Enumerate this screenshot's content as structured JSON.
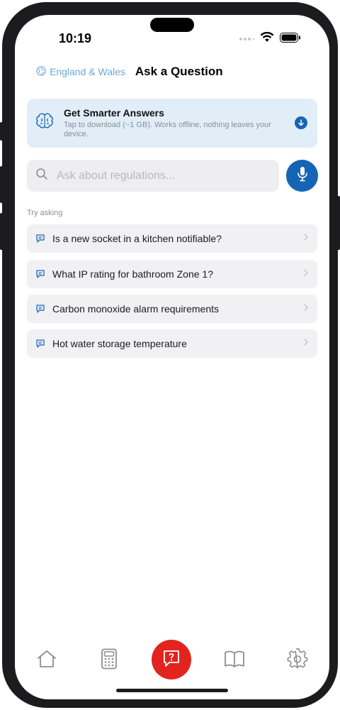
{
  "status_bar": {
    "time": "10:19"
  },
  "header": {
    "region": "England & Wales",
    "title": "Ask a Question"
  },
  "banner": {
    "title": "Get Smarter Answers",
    "subtitle": "Tap to download (~1 GB). Works offline, nothing leaves your device."
  },
  "search": {
    "placeholder": "Ask about regulations..."
  },
  "suggestions": {
    "heading": "Try asking",
    "items": [
      {
        "label": "Is a new socket in a kitchen notifiable?"
      },
      {
        "label": "What IP rating for bathroom Zone 1?"
      },
      {
        "label": "Carbon monoxide alarm requirements"
      },
      {
        "label": "Hot water storage temperature"
      }
    ]
  },
  "tab_bar": {
    "items": [
      "home-icon",
      "calculator-icon",
      "ask-question-icon",
      "book-icon",
      "gear-icon"
    ],
    "active": "ask-question-icon"
  },
  "colors": {
    "accent": "#1565b4",
    "fab": "#e3241e",
    "region": "#6aa8e0",
    "banner_bg": "#e1eef8"
  }
}
